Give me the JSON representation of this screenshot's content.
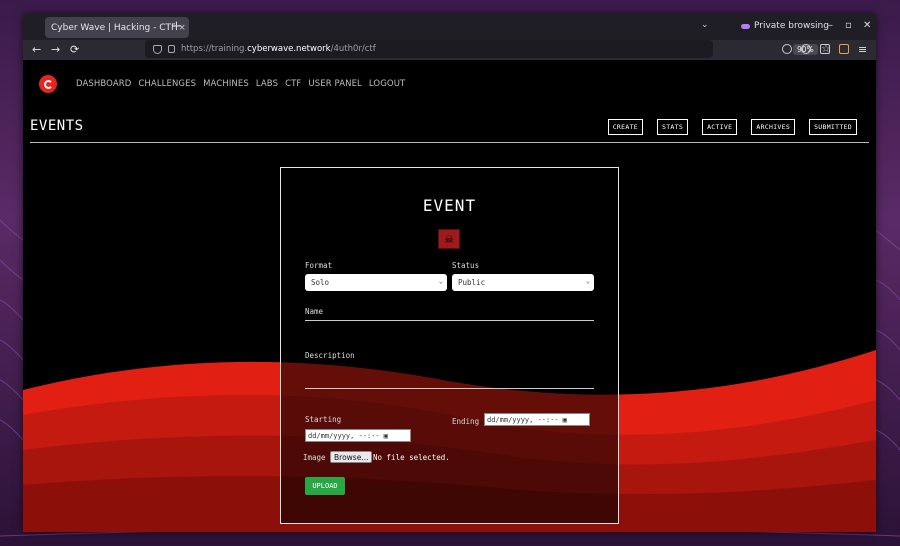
{
  "browser": {
    "tab_title": "Cyber Wave | Hacking - CTF",
    "tab_close": "×",
    "new_tab": "+",
    "tab_list": "⌄",
    "private_label": "Private browsing",
    "win_minimize": "–",
    "win_maximize": "▫",
    "win_close": "✕",
    "back": "←",
    "forward": "→",
    "reload": "⟳",
    "url_prefix": "https://training.",
    "url_host": "cyberwave.network",
    "url_path": "/4uth0r/ctf",
    "zoom": "90%",
    "bookmark": "☆",
    "menu": "≡"
  },
  "nav": {
    "items": [
      "DASHBOARD",
      "CHALLENGES",
      "MACHINES",
      "LABS",
      "CTF",
      "USER PANEL",
      "LOGOUT"
    ]
  },
  "header": {
    "title": "EVENTS",
    "actions": [
      "CREATE",
      "STATS",
      "ACTIVE",
      "ARCHIVES",
      "SUBMITTED"
    ]
  },
  "form": {
    "title": "EVENT",
    "emblem": "☠",
    "format_label": "Format",
    "format_value": "Solo",
    "status_label": "Status",
    "status_value": "Public",
    "select_arrow": "⌄",
    "name_label": "Name",
    "description_label": "Description",
    "starting_label": "Starting",
    "starting_value": "dd/mm/yyyy, --:--",
    "ending_label": "Ending",
    "ending_value": "dd/mm/yyyy, --:--",
    "calendar_icon": "▣",
    "image_label": "Image",
    "browse_label": "Browse...",
    "no_file_text": "No file selected.",
    "upload_label": "UPLOAD"
  },
  "colors": {
    "accent_red": "#e52620",
    "upload_green": "#28a745"
  }
}
